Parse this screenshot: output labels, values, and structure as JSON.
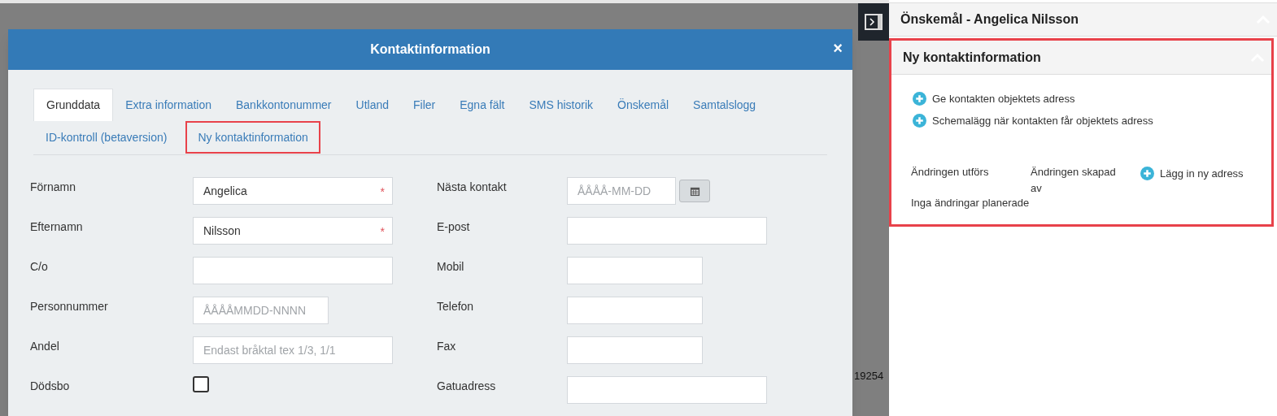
{
  "background": {
    "right_text": "19254"
  },
  "modal": {
    "title": "Kontaktinformation",
    "close": "×",
    "tabs": [
      {
        "label": "Grunddata",
        "selected": true,
        "highlighted": false
      },
      {
        "label": "Extra information",
        "selected": false,
        "highlighted": false
      },
      {
        "label": "Bankkontonummer",
        "selected": false,
        "highlighted": false
      },
      {
        "label": "Utland",
        "selected": false,
        "highlighted": false
      },
      {
        "label": "Filer",
        "selected": false,
        "highlighted": false
      },
      {
        "label": "Egna fält",
        "selected": false,
        "highlighted": false
      },
      {
        "label": "SMS historik",
        "selected": false,
        "highlighted": false
      },
      {
        "label": "Önskemål",
        "selected": false,
        "highlighted": false
      },
      {
        "label": "Samtalslogg",
        "selected": false,
        "highlighted": false
      },
      {
        "label": "ID-kontroll (betaversion)",
        "selected": false,
        "highlighted": false
      },
      {
        "label": "Ny kontaktinformation",
        "selected": false,
        "highlighted": true
      }
    ],
    "left_fields": [
      {
        "label": "Förnamn",
        "kind": "text",
        "narrow": false,
        "value": "Angelica",
        "required_mark": "*"
      },
      {
        "label": "Efternamn",
        "kind": "text",
        "narrow": false,
        "value": "Nilsson",
        "required_mark": "*"
      },
      {
        "label": "C/o",
        "kind": "text",
        "narrow": false
      },
      {
        "label": "Personnummer",
        "kind": "text",
        "narrow": true,
        "placeholder": "ÅÅÅÅMMDD-NNNN"
      },
      {
        "label": "Andel",
        "kind": "text",
        "narrow": false,
        "placeholder": "Endast bråktal tex 1/3, 1/1"
      },
      {
        "label": "Dödsbo",
        "kind": "checkbox",
        "checked": false
      }
    ],
    "right_fields": [
      {
        "label": "Nästa kontakt",
        "kind": "date",
        "placeholder": "ÅÅÅÅ-MM-DD"
      },
      {
        "label": "E-post",
        "kind": "text",
        "narrow": false
      },
      {
        "label": "Mobil",
        "kind": "text",
        "narrow": true
      },
      {
        "label": "Telefon",
        "kind": "text",
        "narrow": true
      },
      {
        "label": "Fax",
        "kind": "text",
        "narrow": true
      },
      {
        "label": "Gatuadress",
        "kind": "text",
        "narrow": false
      }
    ]
  },
  "side_panel": {
    "sections": [
      {
        "title": "Önskemål - Angelica Nilsson",
        "highlighted": false
      },
      {
        "title": "Ny kontaktinformation",
        "highlighted": true,
        "actions": [
          "Ge kontakten objektets adress",
          "Schemalägg när kontakten får objektets adress"
        ],
        "columns": [
          "Ändringen utförs",
          "Ändringen skapad av"
        ],
        "add_action": "Lägg in ny adress",
        "empty_text": "Inga ändringar planerade"
      }
    ]
  }
}
